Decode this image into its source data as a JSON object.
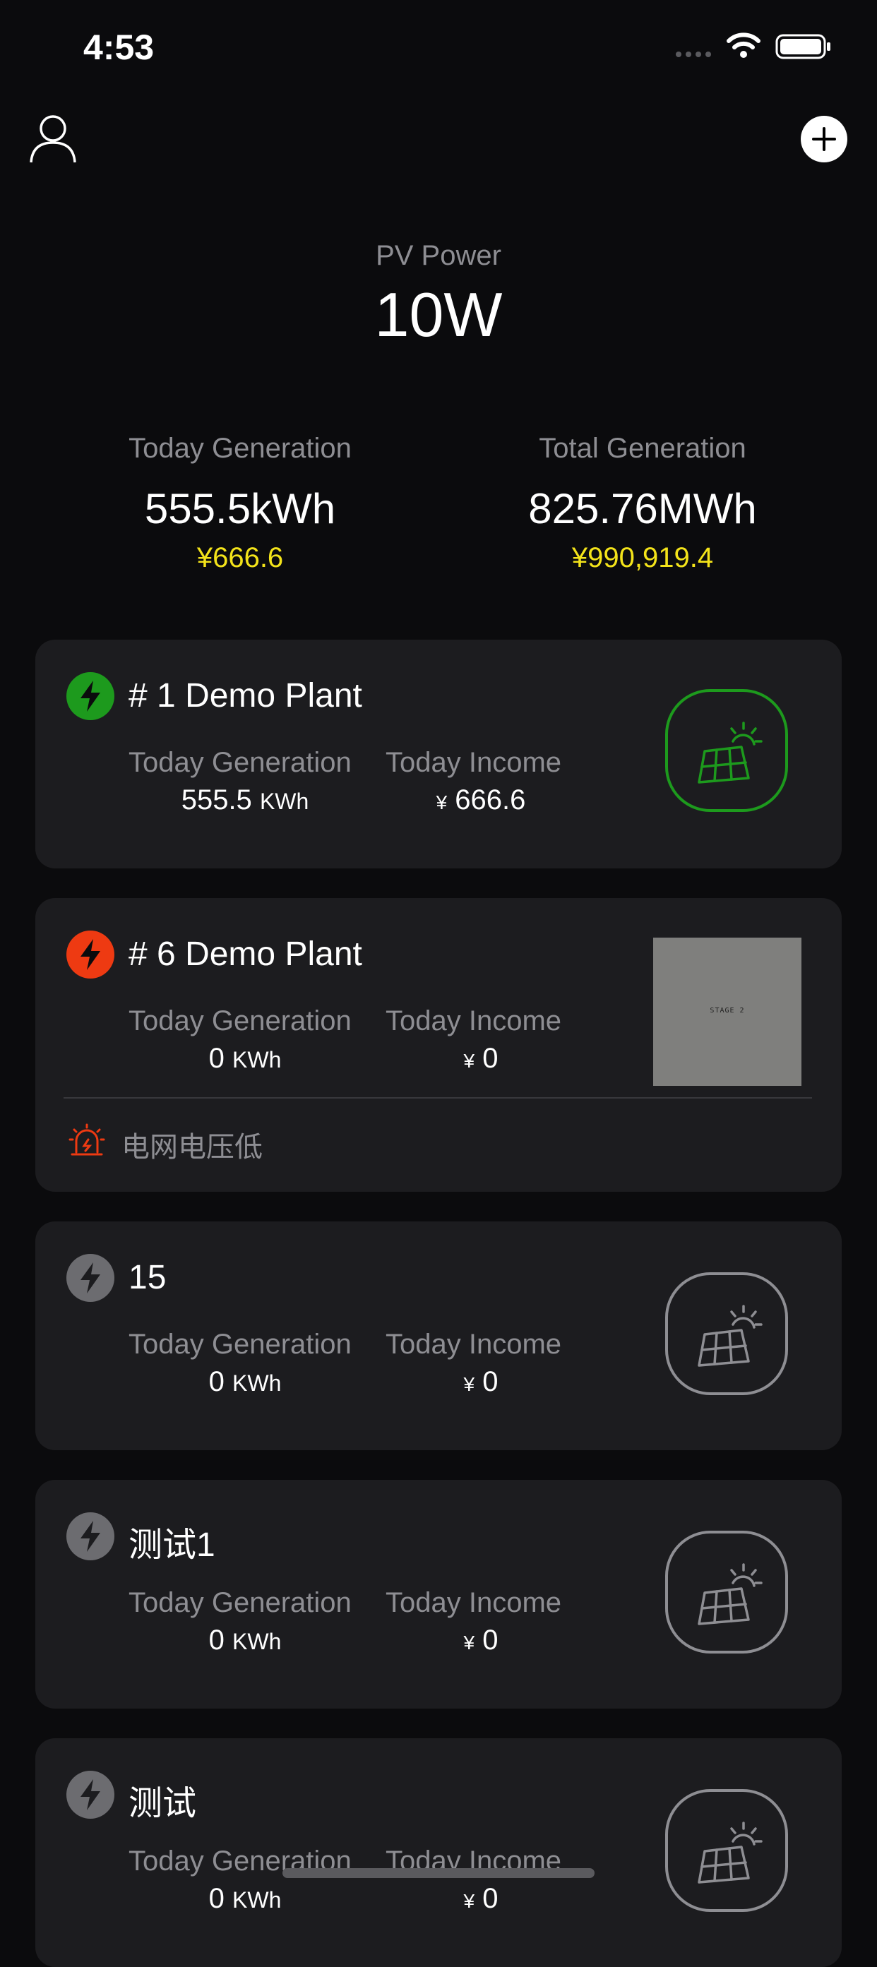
{
  "status_bar": {
    "time": "4:53"
  },
  "header": {
    "pv_label": "PV Power",
    "pv_value": "10W",
    "today_label": "Today Generation",
    "today_value": "555.5kWh",
    "today_money": "¥666.6",
    "total_label": "Total Generation",
    "total_value": "825.76MWh",
    "total_money": "¥990,919.4"
  },
  "labels": {
    "today_generation": "Today Generation",
    "today_income": "Today Income",
    "unit": "KWh",
    "currency": "¥"
  },
  "plants": [
    {
      "title": "# 1 Demo Plant",
      "generation": "555.5",
      "income": "666.6",
      "status": "online",
      "status_color": "#1d9a1d",
      "image": "solar-panel-icon"
    },
    {
      "title": "# 6 Demo Plant",
      "generation": "0",
      "income": "0",
      "status": "fault",
      "status_color": "#ee3a12",
      "image_text": "STAGE 2",
      "alarm": "电网电压低"
    },
    {
      "title": "15",
      "generation": "0",
      "income": "0",
      "status": "offline",
      "status_color": "#6c6c70",
      "image": "solar-panel-icon"
    },
    {
      "title": "测试1",
      "generation": "0",
      "income": "0",
      "status": "offline",
      "status_color": "#6c6c70",
      "image": "solar-panel-icon"
    },
    {
      "title": "测试",
      "generation": "0",
      "income": "0",
      "status": "offline",
      "status_color": "#6c6c70",
      "image": "solar-panel-icon"
    }
  ],
  "colors": {
    "background": "#0b0b0d",
    "card": "#1c1c1f",
    "money": "#f3e31a",
    "muted": "#8e8e93"
  }
}
